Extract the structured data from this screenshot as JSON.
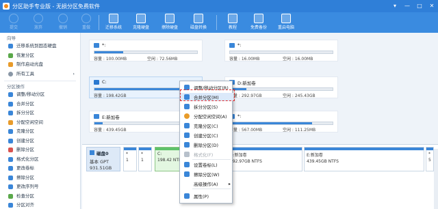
{
  "window": {
    "title": "分区助手专业版 - 无损分区免费软件",
    "controls": [
      "▾",
      "—",
      "□",
      "✕"
    ]
  },
  "toolbar": {
    "items": [
      {
        "label": "提交",
        "icon": "submit-icon",
        "enabled": false
      },
      {
        "label": "放弃",
        "icon": "discard-icon",
        "enabled": false
      },
      {
        "label": "撤销",
        "icon": "undo-icon",
        "enabled": false
      },
      {
        "label": "重做",
        "icon": "redo-icon",
        "enabled": false
      },
      {
        "label": "迁移系统",
        "icon": "migrate-icon",
        "enabled": true
      },
      {
        "label": "克隆硬盘",
        "icon": "clone-icon",
        "enabled": true
      },
      {
        "label": "擦除硬盘",
        "icon": "wipe-icon",
        "enabled": true
      },
      {
        "label": "磁盘转换",
        "icon": "convert-icon",
        "enabled": true
      },
      {
        "label": "教程",
        "icon": "tutorial-icon",
        "enabled": true
      },
      {
        "label": "免费备份",
        "icon": "backup-icon",
        "enabled": true
      },
      {
        "label": "重启电脑",
        "icon": "reboot-icon",
        "enabled": true
      }
    ]
  },
  "sidebar": {
    "wizard_header": "向导",
    "wizard_items": [
      {
        "label": "迁移系统到固态硬盘",
        "icon": "migrate-ssd-icon"
      },
      {
        "label": "恢复分区",
        "icon": "recover-icon"
      },
      {
        "label": "制作启动光盘",
        "icon": "bootdisk-icon"
      },
      {
        "label": "所有工具",
        "icon": "more-icon",
        "arrow": "›"
      }
    ],
    "ops_header": "分区操作",
    "ops_items": [
      {
        "label": "调整/移动分区",
        "icon": "resize-icon"
      },
      {
        "label": "合并分区",
        "icon": "merge-icon"
      },
      {
        "label": "拆分分区",
        "icon": "split-icon"
      },
      {
        "label": "分配空闲空间",
        "icon": "allocate-icon"
      },
      {
        "label": "克隆分区",
        "icon": "clone-partition-icon"
      },
      {
        "label": "创建分区",
        "icon": "create-icon"
      },
      {
        "label": "删除分区",
        "icon": "delete-icon"
      },
      {
        "label": "格式化分区",
        "icon": "format-icon"
      },
      {
        "label": "更改卷标",
        "icon": "label-icon"
      },
      {
        "label": "擦除分区",
        "icon": "wipe-partition-icon"
      },
      {
        "label": "更改序列号",
        "icon": "serial-icon"
      },
      {
        "label": "检查分区",
        "icon": "check-icon"
      },
      {
        "label": "分区对齐",
        "icon": "align-icon"
      }
    ]
  },
  "partitions": [
    {
      "name": "*:",
      "capacity": "容量 : 100.00MB",
      "free": "空闲 : 72.56MB",
      "used": 0.28,
      "icon": "disk-icon"
    },
    {
      "name": "*:",
      "capacity": "容量 : 16.00MB",
      "free": "空闲 : 16.00MB",
      "used": 0.0,
      "icon": "disk-icon"
    },
    {
      "name": "C:",
      "capacity": "容量 : 198.42GB",
      "free": "",
      "used": 0.93,
      "icon": "windows-disk-icon"
    },
    {
      "name": "D:新加卷",
      "capacity": "容量 : 292.97GB",
      "free": "空闲 : 245.43GB",
      "used": 0.16,
      "icon": "disk-icon"
    },
    {
      "name": "E:新加卷",
      "capacity": "容量 : 439.45GB",
      "free": "",
      "used": 0.08,
      "icon": "disk-icon"
    },
    {
      "name": "*:",
      "capacity": "容量 : 567.00MB",
      "free": "空闲 : 111.25MB",
      "used": 0.8,
      "icon": "disk-icon"
    }
  ],
  "disk": {
    "name": "磁盘0",
    "type": "基本 GPT",
    "size": "931.51GB",
    "map": [
      {
        "label": "*",
        "detail": "1",
        "selected": false
      },
      {
        "label": "*",
        "detail": "1",
        "selected": false
      },
      {
        "label": "C:",
        "detail": "198.42 NTFS",
        "selected": true
      },
      {
        "label": "D:新加卷",
        "detail": "292.97GB NTFS",
        "selected": false
      },
      {
        "label": "E:新加卷",
        "detail": "439.45GB NTFS",
        "selected": false
      },
      {
        "label": "*",
        "detail": "5",
        "selected": false
      }
    ]
  },
  "context_menu": {
    "items": [
      {
        "label": "调整/移动分区(R)",
        "enabled": true,
        "highlighted": false
      },
      {
        "label": "合并分区(M)",
        "enabled": true,
        "highlighted": true
      },
      {
        "label": "拆分分区(S)",
        "enabled": true,
        "highlighted": false
      },
      {
        "label": "分配空闲空间(A)",
        "enabled": true,
        "highlighted": false
      },
      {
        "label": "克隆分区(C)",
        "enabled": true,
        "highlighted": false
      },
      {
        "label": "创建分区(C)",
        "enabled": true,
        "highlighted": false
      },
      {
        "label": "删除分区(D)",
        "enabled": true,
        "highlighted": false
      },
      {
        "label": "格式化(F)",
        "enabled": false,
        "highlighted": false
      },
      {
        "label": "设置卷标(L)",
        "enabled": true,
        "highlighted": false
      },
      {
        "label": "擦除分区(W)",
        "enabled": true,
        "highlighted": false
      },
      {
        "label": "高级操作(A)",
        "enabled": true,
        "highlighted": false,
        "submenu": "▸"
      },
      {
        "label": "属性(P)",
        "enabled": true,
        "highlighted": false
      }
    ]
  },
  "colors": {
    "titlebar": "#2f7fd8",
    "toolbar": "#3a8be0",
    "partition_bar": "#3a86d8",
    "selected_partition": "#5ec26a",
    "highlight_box": "#e02a2a"
  }
}
